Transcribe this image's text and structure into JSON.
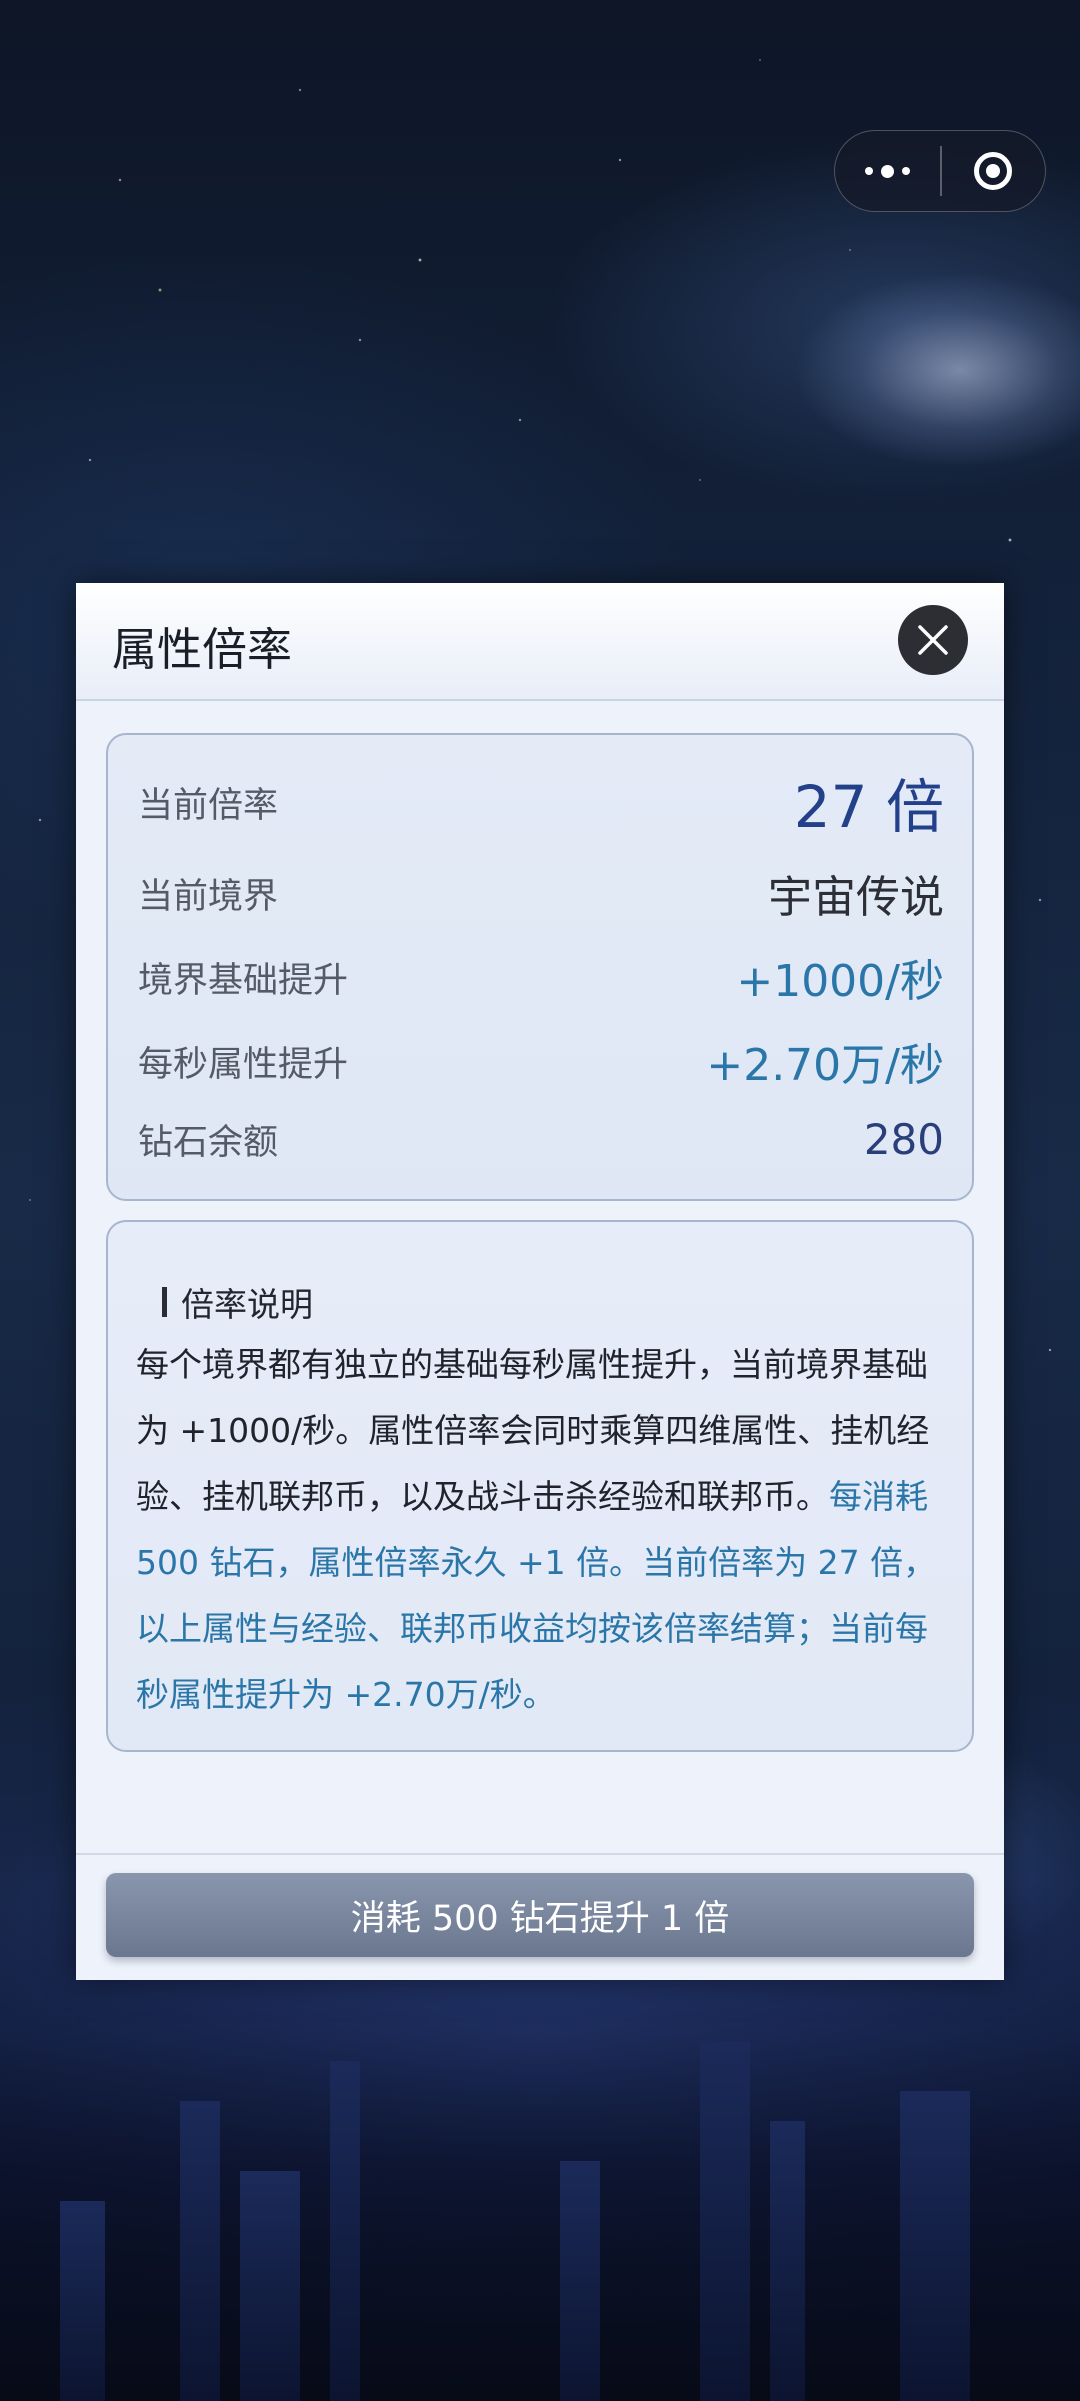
{
  "capsule": {
    "more_icon": "more-dots-icon",
    "close_icon": "target-ring-icon"
  },
  "modal": {
    "title": "属性倍率",
    "close_icon": "close-icon"
  },
  "stats": [
    {
      "label": "当前倍率",
      "value": "27 倍"
    },
    {
      "label": "当前境界",
      "value": "宇宙传说"
    },
    {
      "label": "境界基础提升",
      "value": "+1000/秒"
    },
    {
      "label": "每秒属性提升",
      "value": "+2.70万/秒"
    },
    {
      "label": "钻石余额",
      "value": "280"
    }
  ],
  "description": {
    "heading": "倍率说明",
    "text": "每个境界都有独立的基础每秒属性提升，当前境界基础为 +1000/秒。属性倍率会同时乘算四维属性、挂机经验、挂机联邦币，以及战斗击杀经验和联邦币。",
    "highlight": "每消耗 500 钻石，属性倍率永久 +1 倍。当前倍率为 27 倍，以上属性与经验、联邦币收益均按该倍率结算；当前每秒属性提升为 +2.70万/秒。"
  },
  "action": {
    "label": "消耗 500 钻石提升 1 倍"
  },
  "colors": {
    "accent_blue": "#2b76a8",
    "title_navy": "#23418a",
    "button": "#7a86a0"
  }
}
